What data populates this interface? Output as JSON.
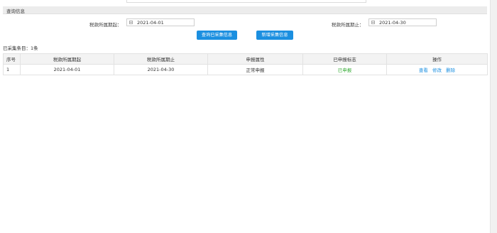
{
  "section": {
    "title": "查询信息"
  },
  "form": {
    "start_label": "税款所属期起：",
    "start_value": "2021-04-01",
    "end_label": "税款所属期止：",
    "end_value": "2021-04-30",
    "query_button": "查询已采集信息",
    "add_button": "新增采集信息"
  },
  "summary": {
    "count_text": "已采集条目：1条"
  },
  "table": {
    "headers": [
      "序号",
      "税款所属期起",
      "税款所属期止",
      "申报属性",
      "已申报标志",
      "操作"
    ],
    "rows": [
      {
        "index": "1",
        "start": "2021-04-01",
        "end": "2021-04-30",
        "attribute": "正常申报",
        "status": "已申报",
        "actions": [
          "查看",
          "修改",
          "删除"
        ]
      }
    ]
  },
  "colors": {
    "primary": "#1b8fe0",
    "success": "#33aa33",
    "header_bg": "#ececec"
  }
}
